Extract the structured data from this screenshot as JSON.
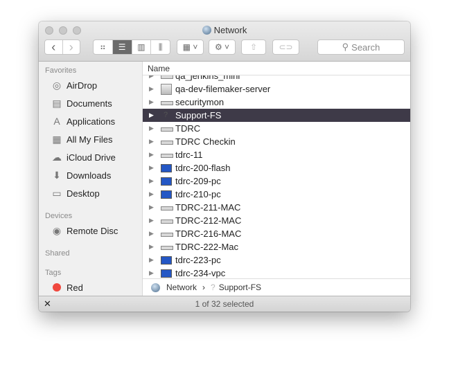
{
  "window": {
    "title": "Network"
  },
  "toolbar": {
    "back": "‹",
    "forward": "›",
    "views": [
      "icon",
      "list",
      "column",
      "coverflow"
    ],
    "active_view": "list",
    "arrange": "arrange",
    "action": "action",
    "share": "share",
    "tags": "tags",
    "search_placeholder": "Search"
  },
  "sidebar": {
    "favorites_label": "Favorites",
    "favorites": [
      {
        "label": "AirDrop",
        "icon": "◎"
      },
      {
        "label": "Documents",
        "icon": "▤"
      },
      {
        "label": "Applications",
        "icon": "A"
      },
      {
        "label": "All My Files",
        "icon": "▦"
      },
      {
        "label": "iCloud Drive",
        "icon": "☁"
      },
      {
        "label": "Downloads",
        "icon": "⬇"
      },
      {
        "label": "Desktop",
        "icon": "▭"
      }
    ],
    "devices_label": "Devices",
    "devices": [
      {
        "label": "Remote Disc",
        "icon": "◉"
      }
    ],
    "shared_label": "Shared",
    "tags_label": "Tags",
    "tags": [
      {
        "label": "Red",
        "color": "#f0483e"
      }
    ]
  },
  "list": {
    "column_header": "Name",
    "rows": [
      {
        "name": "qa_jenkins_mini",
        "icon": "server"
      },
      {
        "name": "qa-dev-filemaker-server",
        "icon": "box"
      },
      {
        "name": "securitymon",
        "icon": "server"
      },
      {
        "name": "Support-FS",
        "icon": "q",
        "selected": true
      },
      {
        "name": "TDRC",
        "icon": "server"
      },
      {
        "name": "TDRC Checkin",
        "icon": "server"
      },
      {
        "name": "tdrc-11",
        "icon": "server"
      },
      {
        "name": "tdrc-200-flash",
        "icon": "monitor"
      },
      {
        "name": "tdrc-209-pc",
        "icon": "monitor"
      },
      {
        "name": "tdrc-210-pc",
        "icon": "monitor"
      },
      {
        "name": "TDRC-211-MAC",
        "icon": "server"
      },
      {
        "name": "TDRC-212-MAC",
        "icon": "server"
      },
      {
        "name": "TDRC-216-MAC",
        "icon": "server"
      },
      {
        "name": "TDRC-222-Mac",
        "icon": "server"
      },
      {
        "name": "tdrc-223-pc",
        "icon": "monitor"
      },
      {
        "name": "tdrc-234-vpc",
        "icon": "monitor"
      }
    ]
  },
  "pathbar": {
    "items": [
      "Network",
      "Support-FS"
    ],
    "separator": "›"
  },
  "status": {
    "text": "1 of 32 selected"
  }
}
